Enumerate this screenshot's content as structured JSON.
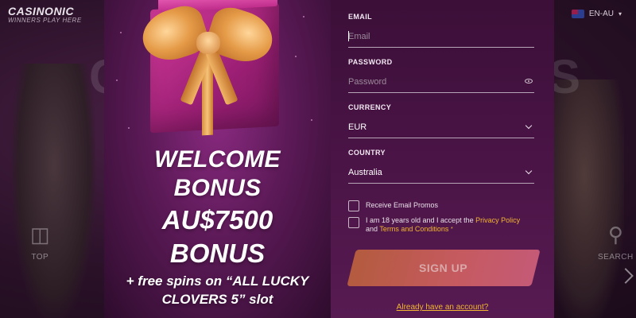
{
  "site": {
    "logo_main": "CASINONIC",
    "logo_sub": "WINNERS PLAY HERE",
    "language": "EN-AU",
    "nav_left_label": "TOP",
    "nav_right_label": "SEARCH",
    "bg_letter_left": "C",
    "bg_letter_right": "S"
  },
  "promo": {
    "line1": "WELCOME",
    "line2": "BONUS",
    "amount": "AU$7500",
    "line4": "BONUS",
    "free_spins_line1": "+ free spins on “ALL LUCKY",
    "free_spins_line2": "CLOVERS 5” slot"
  },
  "form": {
    "email": {
      "label": "EMAIL",
      "placeholder": "Email",
      "value": ""
    },
    "password": {
      "label": "PASSWORD",
      "placeholder": "Password",
      "value": ""
    },
    "currency": {
      "label": "CURRENCY",
      "value": "EUR"
    },
    "country": {
      "label": "COUNTRY",
      "value": "Australia"
    },
    "email_promos": "Receive Email Promos",
    "terms_prefix": "I am 18 years old and I accept the",
    "privacy_policy": "Privacy Policy",
    "terms_and": "and",
    "terms_conditions": "Terms and Conditions",
    "required_mark": "*",
    "signup_label": "SIGN UP",
    "login_link": "Already have an account?"
  },
  "colors": {
    "accent_link": "#f2b532",
    "button_start": "#b45b3f",
    "button_end": "#c45a76",
    "form_bg": "#4a1446"
  }
}
